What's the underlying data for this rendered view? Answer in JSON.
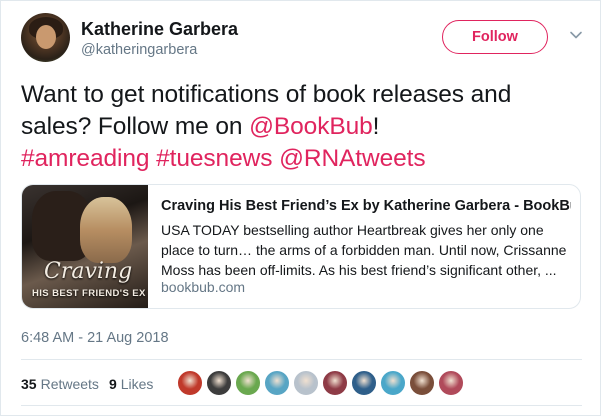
{
  "user": {
    "name": "Katherine Garbera",
    "handle": "@katheringarbera"
  },
  "follow_button": {
    "label": "Follow"
  },
  "tweet": {
    "text_part1": "Want to get notifications of book releases and sales? Follow me on ",
    "mention_bookbub": "@BookBub",
    "text_part2": "!",
    "hashtag_amreading": "#amreading",
    "hashtag_tuesnews": "#tuesnews",
    "mention_rnatweets": "@RNAtweets"
  },
  "card": {
    "image_title": "Craving",
    "image_subtitle": "HIS BEST FRIEND'S EX",
    "title": "Craving His Best Friend’s Ex by Katherine Garbera - BookBub",
    "description": "USA TODAY bestselling author Heartbreak gives her only one place to turn… the arms of a forbidden man. Until now, Crissanne Moss has been off-limits. As his best friend’s significant other, ...",
    "domain": "bookbub.com"
  },
  "timestamp": "6:48 AM - 21 Aug 2018",
  "stats": {
    "retweets_count": "35",
    "retweets_label": "Retweets",
    "likes_count": "9",
    "likes_label": "Likes"
  },
  "likers": [
    {
      "color": "#c0392b"
    },
    {
      "color": "#3d3d3d"
    },
    {
      "color": "#6aa84f"
    },
    {
      "color": "#58a5c4"
    },
    {
      "color": "#b8c2cc"
    },
    {
      "color": "#8e3b46"
    },
    {
      "color": "#2f5f8a"
    },
    {
      "color": "#4aa7c9"
    },
    {
      "color": "#7a4e3a"
    },
    {
      "color": "#b04a5a"
    }
  ],
  "colors": {
    "accent": "#e0245e",
    "secondary_text": "#657786",
    "border": "#e1e8ed"
  },
  "icons": {
    "menu": "chevron-down-icon"
  }
}
